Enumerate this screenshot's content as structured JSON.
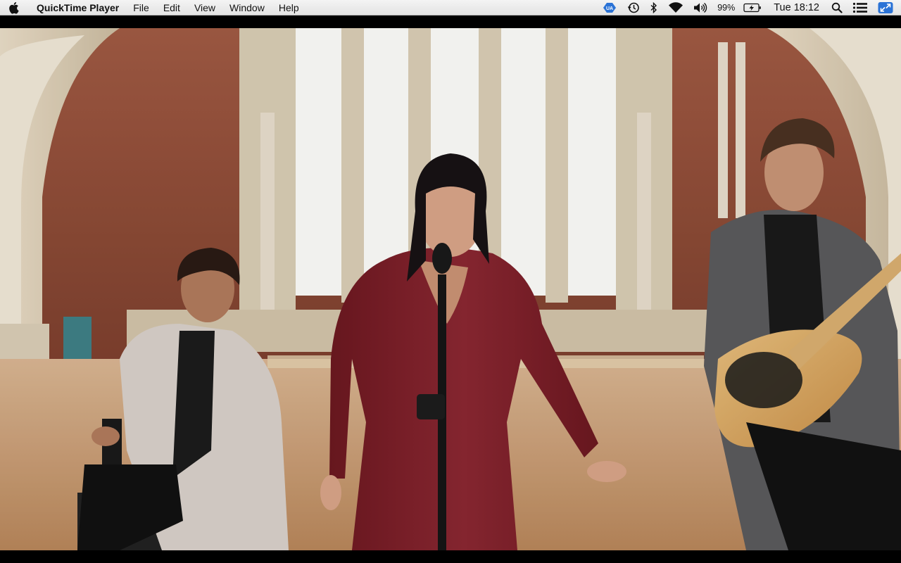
{
  "menubar": {
    "app_name": "QuickTime Player",
    "menus": [
      "File",
      "Edit",
      "View",
      "Window",
      "Help"
    ],
    "status": {
      "battery_percent": "99%",
      "clock": "Tue 18:12"
    },
    "icons": [
      "apple-logo-icon",
      "vpn-icon",
      "time-machine-icon",
      "bluetooth-icon",
      "wifi-icon",
      "volume-icon",
      "battery-icon",
      "spotlight-search-icon",
      "notification-center-icon",
      "screen-mirroring-icon"
    ]
  },
  "player": {
    "content": "video-frame"
  },
  "colors": {
    "menubar_bg": "#ececec",
    "letterbox": "#000000",
    "dress": "#7a1f28",
    "brick": "#8e4a35",
    "floor": "#c89a6c",
    "window_light": "#fbfbf8",
    "accent_blue": "#2b73d6"
  }
}
